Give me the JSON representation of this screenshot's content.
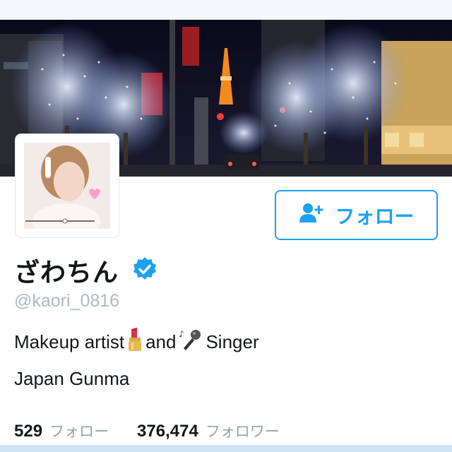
{
  "profile": {
    "display_name": "ざわちん",
    "handle": "@kaori_0816",
    "bio_part1": "Makeup artist",
    "bio_part2": "and",
    "bio_part3": "Singer",
    "location": "Japan Gunma"
  },
  "actions": {
    "follow_label": "フォロー"
  },
  "stats": {
    "following_count": "529",
    "following_label": "フォロー",
    "followers_count": "376,474",
    "followers_label": "フォロワー"
  },
  "icons": {
    "verified": "verified-badge-icon",
    "follow": "add-user-icon",
    "lipstick": "lipstick-icon",
    "microphone": "microphone-icon"
  },
  "colors": {
    "accent": "#1da1f2",
    "handle_gray": "#b0b9c2",
    "label_gray": "#98a2ab",
    "text": "#14171a"
  }
}
